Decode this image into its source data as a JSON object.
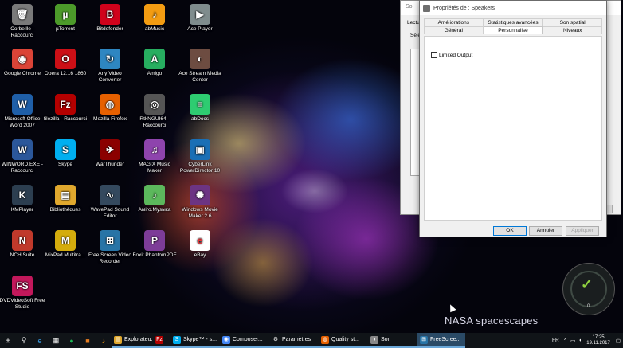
{
  "desktop": {
    "wallpaper_caption": "NASA spacescapes",
    "icons": [
      {
        "label": "Corbeille - Raccourci",
        "glyph": "🗑",
        "color": "#7a7a7a"
      },
      {
        "label": "µTorrent",
        "glyph": "µ",
        "color": "#4c9a2a"
      },
      {
        "label": "Bitdefender",
        "glyph": "B",
        "color": "#d0021b"
      },
      {
        "label": "abMusic",
        "glyph": "♪",
        "color": "#f39c12"
      },
      {
        "label": "Ace Player",
        "glyph": "▶",
        "color": "#7f8c8d"
      },
      {
        "label": "Google Chrome",
        "glyph": "◉",
        "color": "#db4437"
      },
      {
        "label": "Opera 12.16 1860",
        "glyph": "O",
        "color": "#cc0f16"
      },
      {
        "label": "Any Video Converter",
        "glyph": "↻",
        "color": "#2e86c1"
      },
      {
        "label": "Amigo",
        "glyph": "A",
        "color": "#27ae60"
      },
      {
        "label": "Ace Stream Media Center",
        "glyph": "◐",
        "color": "#6d4c41"
      },
      {
        "label": "Microsoft Office Word 2007",
        "glyph": "W",
        "color": "#1f5fa8"
      },
      {
        "label": "filezilla - Raccourci",
        "glyph": "Fz",
        "color": "#b40000"
      },
      {
        "label": "Mozilla Firefox",
        "glyph": "◍",
        "color": "#e66000"
      },
      {
        "label": "RtkNGUI64 - Raccourci",
        "glyph": "◎",
        "color": "#555555"
      },
      {
        "label": "abDocs",
        "glyph": "≡",
        "color": "#2ecc71"
      },
      {
        "label": "WINWORD.EXE - Raccourci",
        "glyph": "W",
        "color": "#2b579a"
      },
      {
        "label": "Skype",
        "glyph": "S",
        "color": "#00aff0"
      },
      {
        "label": "WarThunder",
        "glyph": "✈",
        "color": "#8b0000"
      },
      {
        "label": "MAGIX Music Maker",
        "glyph": "♫",
        "color": "#8e44ad"
      },
      {
        "label": "CyberLink PowerDirector 10",
        "glyph": "▣",
        "color": "#1a6fb5"
      },
      {
        "label": "KMPlayer",
        "glyph": "K",
        "color": "#2c3e50"
      },
      {
        "label": "Bibliothèques",
        "glyph": "▤",
        "color": "#e0a82e"
      },
      {
        "label": "WavePad Sound Editor",
        "glyph": "∿",
        "color": "#34495e"
      },
      {
        "label": "Аміго.Музыка",
        "glyph": "♪",
        "color": "#5cb85c"
      },
      {
        "label": "Windows Movie Maker 2.6",
        "glyph": "✺",
        "color": "#6c3483"
      },
      {
        "label": "NCH Suite",
        "glyph": "N",
        "color": "#c0392b"
      },
      {
        "label": "MixPad Multitra...",
        "glyph": "M",
        "color": "#d4ac0d"
      },
      {
        "label": "Free Screen Video Recorder",
        "glyph": "⊞",
        "color": "#2874a6"
      },
      {
        "label": "Foxit PhantomPDF",
        "glyph": "P",
        "color": "#7d3c98"
      },
      {
        "label": "eBay",
        "glyph": "e",
        "color": "#ffffff"
      },
      {
        "label": "DVDVideoSoft Free Studio",
        "glyph": "FS",
        "color": "#c2185b"
      }
    ]
  },
  "back_window": {
    "title": "So",
    "tab": "Lectu",
    "sel": "Séle",
    "btn": "r"
  },
  "dialog": {
    "title": "Propriétés de : Speakers",
    "tabs_row1": [
      "Améliorations",
      "Statistiques avancées",
      "Son spatial"
    ],
    "tabs_row2": [
      "Général",
      "Personnalisé",
      "Niveaux"
    ],
    "active_tab": "Personnalisé",
    "checkbox_label": "Limited Output",
    "checkbox_checked": false,
    "buttons": {
      "ok": "OK",
      "cancel": "Annuler",
      "apply": "Appliquer"
    }
  },
  "widget": {
    "count": "0"
  },
  "taskbar": {
    "apps": [
      {
        "label": "Explorateu...",
        "color": "#e0a82e",
        "glyph": "▤"
      },
      {
        "label": "",
        "color": "#b40000",
        "glyph": "Fz"
      },
      {
        "label": "Skype™ - s...",
        "color": "#00aff0",
        "glyph": "S"
      },
      {
        "label": "Composer...",
        "color": "#4285f4",
        "glyph": "◉"
      },
      {
        "label": "Paramètres",
        "color": "#101418",
        "glyph": "⚙"
      },
      {
        "label": "Quality st...",
        "color": "#e66000",
        "glyph": "◍"
      },
      {
        "label": "Son",
        "color": "#888888",
        "glyph": "◖"
      },
      {
        "label": "FreeScree...",
        "color": "#2874a6",
        "glyph": "⊞"
      }
    ],
    "language": "FR",
    "time": "17:25",
    "date": "19.11.2017"
  }
}
